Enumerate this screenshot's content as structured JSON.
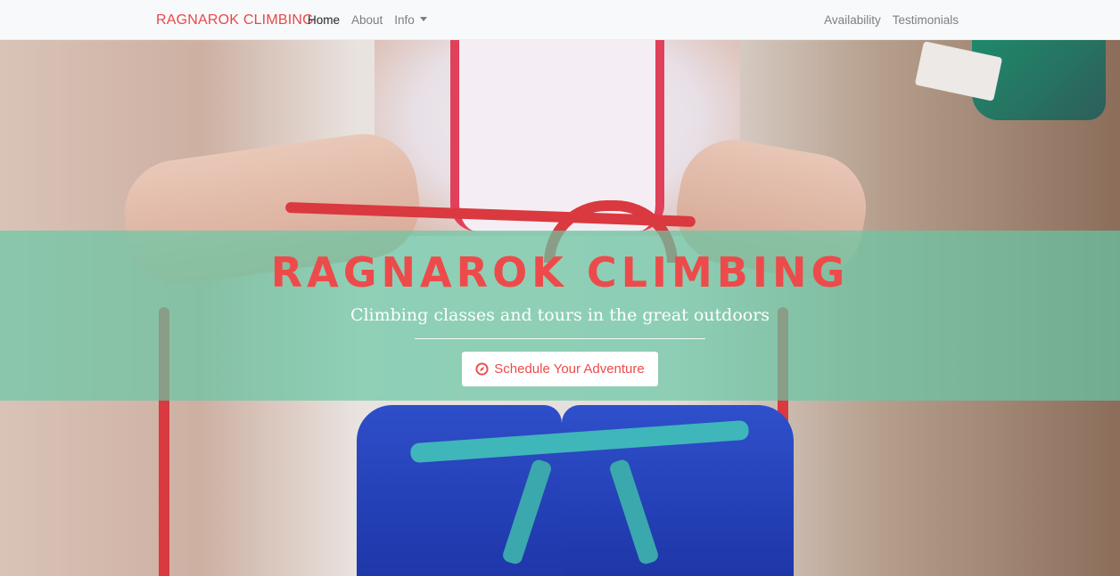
{
  "navbar": {
    "brand": "RAGNAROK CLIMBING",
    "left_links": [
      {
        "label": "Home",
        "active": true
      },
      {
        "label": "About",
        "active": false
      },
      {
        "label": "Info",
        "active": false,
        "dropdown": true
      }
    ],
    "right_links": [
      {
        "label": "Availability"
      },
      {
        "label": "Testimonials"
      }
    ]
  },
  "hero": {
    "title": "RAGNAROK CLIMBING",
    "subtitle": "Climbing classes and tours in the great outdoors",
    "cta_label": "Schedule Your Adventure",
    "cta_icon": "compass-icon"
  },
  "colors": {
    "brand": "#e8484a",
    "overlay": "#68c8a5",
    "navbar_bg": "#f8f9fa"
  }
}
